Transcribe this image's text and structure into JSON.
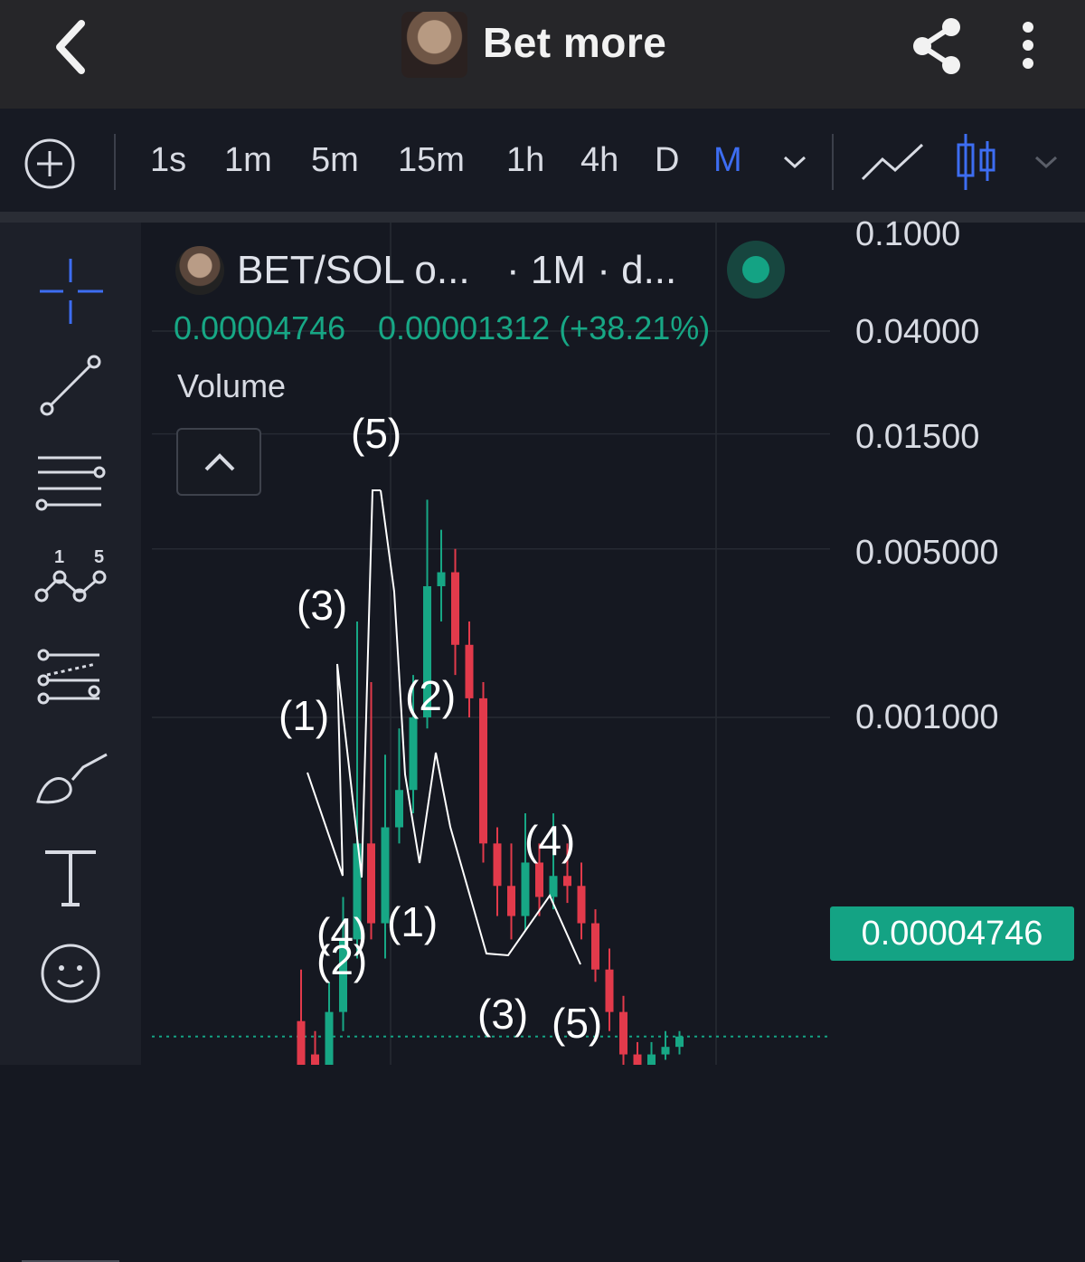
{
  "header": {
    "title": "Bet more",
    "back_icon": "chevron-left-icon",
    "share_icon": "share-icon",
    "more_icon": "more-vertical-icon"
  },
  "toolbar": {
    "intervals": [
      "1s",
      "1m",
      "5m",
      "15m",
      "1h",
      "4h",
      "D",
      "M"
    ],
    "active_interval": "M",
    "accent_color": "#3d6df2"
  },
  "legend": {
    "symbol": "BET/SOL o...",
    "period": "· 1M · d...",
    "price": "0.00004746",
    "change": "0.00001312 (+38.21%)",
    "volume_label": "Volume",
    "up_color": "#17a785"
  },
  "y_axis": {
    "labels": [
      "0.1000",
      "0.04000",
      "0.01500",
      "0.005000",
      "0.001000"
    ],
    "current_price": "0.00004746"
  },
  "waves": {
    "labels": [
      "(5)",
      "(3)",
      "(1)",
      "(2)",
      "(4)",
      "(2)",
      "(1)",
      "(4)",
      "(3)",
      "(5)"
    ]
  },
  "chart_data": {
    "type": "candlestick",
    "y_scale": "log",
    "series": [
      {
        "name": "BET/SOL",
        "values": [
          {
            "o": 5.5e-05,
            "c": 3e-05,
            "h": 9e-05,
            "l": 2.5e-05
          },
          {
            "o": 4e-05,
            "c": 2.2e-05,
            "h": 5e-05,
            "l": 1.8e-05
          },
          {
            "o": 2e-05,
            "c": 6e-05,
            "h": 8e-05,
            "l": 1.8e-05
          },
          {
            "o": 6e-05,
            "c": 0.00012,
            "h": 0.00018,
            "l": 5e-05
          },
          {
            "o": 0.00012,
            "c": 0.0003,
            "h": 0.0025,
            "l": 0.0001
          },
          {
            "o": 0.0003,
            "c": 0.00014,
            "h": 0.0014,
            "l": 0.00012
          },
          {
            "o": 0.00014,
            "c": 0.00035,
            "h": 0.0007,
            "l": 0.0001
          },
          {
            "o": 0.00035,
            "c": 0.0005,
            "h": 0.0009,
            "l": 0.0003
          },
          {
            "o": 0.0005,
            "c": 0.001,
            "h": 0.0015,
            "l": 0.0004
          },
          {
            "o": 0.001,
            "c": 0.0035,
            "h": 0.008,
            "l": 0.0009
          },
          {
            "o": 0.0035,
            "c": 0.004,
            "h": 0.006,
            "l": 0.0025
          },
          {
            "o": 0.004,
            "c": 0.002,
            "h": 0.005,
            "l": 0.0015
          },
          {
            "o": 0.002,
            "c": 0.0012,
            "h": 0.0025,
            "l": 0.001
          },
          {
            "o": 0.0012,
            "c": 0.0003,
            "h": 0.0014,
            "l": 0.00025
          },
          {
            "o": 0.0003,
            "c": 0.0002,
            "h": 0.00035,
            "l": 0.00015
          },
          {
            "o": 0.0002,
            "c": 0.00015,
            "h": 0.0003,
            "l": 0.00012
          },
          {
            "o": 0.00015,
            "c": 0.00025,
            "h": 0.0004,
            "l": 0.00013
          },
          {
            "o": 0.00025,
            "c": 0.00018,
            "h": 0.0003,
            "l": 0.00015
          },
          {
            "o": 0.00018,
            "c": 0.00022,
            "h": 0.0004,
            "l": 0.00016
          },
          {
            "o": 0.00022,
            "c": 0.0002,
            "h": 0.0003,
            "l": 0.00017
          },
          {
            "o": 0.0002,
            "c": 0.00014,
            "h": 0.00025,
            "l": 0.00012
          },
          {
            "o": 0.00014,
            "c": 9e-05,
            "h": 0.00016,
            "l": 8e-05
          },
          {
            "o": 9e-05,
            "c": 6e-05,
            "h": 0.00011,
            "l": 5e-05
          },
          {
            "o": 6e-05,
            "c": 4e-05,
            "h": 7e-05,
            "l": 3.5e-05
          },
          {
            "o": 4e-05,
            "c": 3.3e-05,
            "h": 4.5e-05,
            "l": 3e-05
          },
          {
            "o": 3.3e-05,
            "c": 4e-05,
            "h": 4.5e-05,
            "l": 3.1e-05
          },
          {
            "o": 4e-05,
            "c": 4.3e-05,
            "h": 5e-05,
            "l": 3.8e-05
          },
          {
            "o": 4.3e-05,
            "c": 4.746e-05,
            "h": 5e-05,
            "l": 4e-05
          }
        ]
      }
    ],
    "ylim": [
      1e-05,
      0.15
    ],
    "up_color": "#17a785",
    "down_color": "#e23a4b",
    "grid": true
  }
}
